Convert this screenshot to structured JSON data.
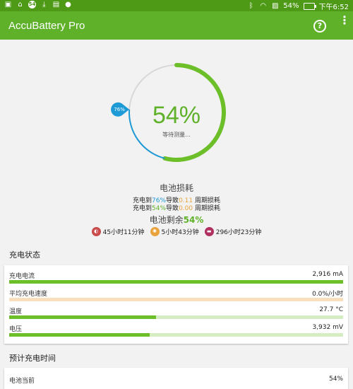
{
  "status_bar": {
    "left_icons": [
      "image-icon",
      "home-icon",
      "badge-54",
      "download-icon",
      "lock-icon",
      "apple-icon"
    ],
    "left_badge_text": "54",
    "battery_text": "54%",
    "time": "下午6:52"
  },
  "app_bar": {
    "title": "AccuBattery Pro",
    "help_icon": "help-circle-icon",
    "more_icon": "more-vert-icon"
  },
  "gauge": {
    "percent_text": "54%",
    "status_text": "等待测量...",
    "charge_level": 0.54,
    "alarm_level": 0.76,
    "alarm_badge": "76%",
    "colors": {
      "green": "#6cbf28",
      "blue": "#1e9ad6",
      "gray": "#d8d8d8"
    }
  },
  "wear": {
    "title": "电池损耗",
    "line1": {
      "prefix": "充电到",
      "level": "76%",
      "mid": "导致",
      "cycles": "0.11",
      "suffix": " 周期损耗"
    },
    "line2": {
      "prefix": "充电到",
      "level": "54%",
      "mid": "导致",
      "cycles": "0.00",
      "suffix": " 周期损耗"
    }
  },
  "remaining": {
    "label": "电池剩余",
    "value": "54%",
    "times": [
      {
        "icon": "screen-on-icon",
        "text": "45小时11分钟",
        "color": "#c94b4b"
      },
      {
        "icon": "screen-off-icon",
        "text": "5小时43分钟",
        "color": "#e8a33c"
      },
      {
        "icon": "sleep-icon",
        "text": "296小时23分钟",
        "color": "#b03060"
      }
    ]
  },
  "charging_status": {
    "title": "充电状态",
    "rows": [
      {
        "label": "充电电流",
        "value": "2,916 mA",
        "fill": 1.0,
        "bar_color": "#6cbf28",
        "track_color": "#d6ecc3"
      },
      {
        "label": "平均充电速度",
        "value": "0.0%/小时",
        "fill": 0.0,
        "bar_color": "#e8a33c",
        "track_color": "#f8dfbd"
      },
      {
        "label": "温度",
        "value": "27.7 °C",
        "fill": 0.44,
        "bar_color": "#6cbf28",
        "track_color": "#d6ecc3"
      },
      {
        "label": "电压",
        "value": "3,932 mV",
        "fill": 0.42,
        "bar_color": "#6cbf28",
        "track_color": "#d6ecc3"
      }
    ]
  },
  "estimate": {
    "title": "预计充电时间",
    "partial_row_label": "电池当前",
    "partial_row_value": "54%"
  }
}
